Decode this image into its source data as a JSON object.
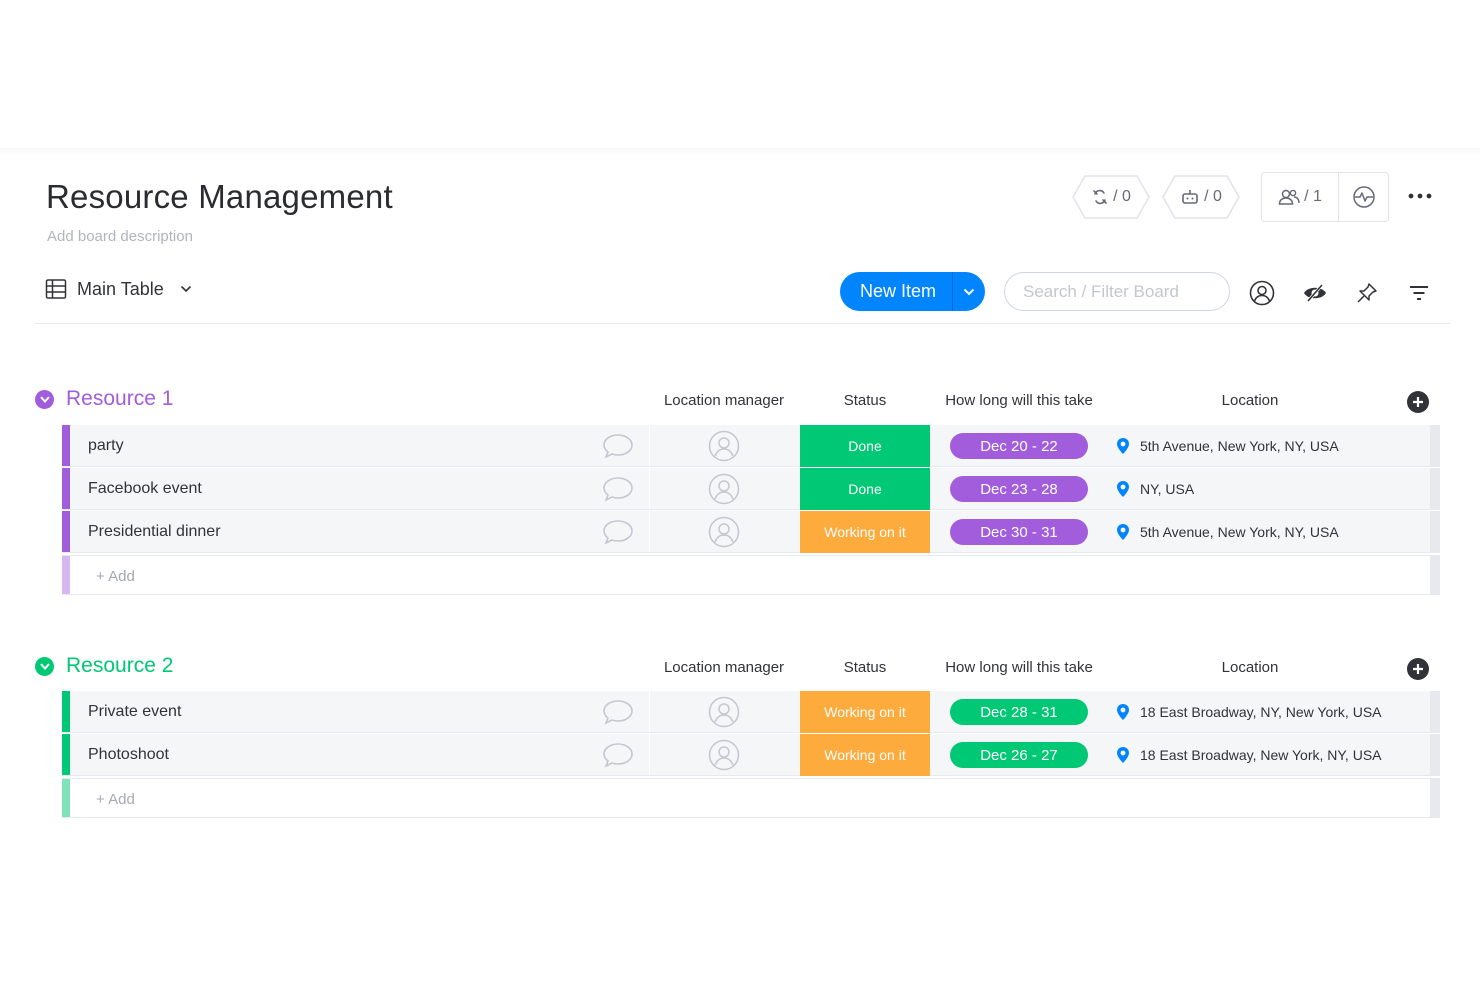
{
  "board": {
    "title": "Resource Management",
    "description_placeholder": "Add board description"
  },
  "header_counters": {
    "integrations": "/ 0",
    "automations": "/ 0",
    "members": "/ 1"
  },
  "toolbar": {
    "view_label": "Main Table",
    "new_item_label": "New Item",
    "search_placeholder": "Search / Filter Board"
  },
  "columns": {
    "location_manager": "Location manager",
    "status": "Status",
    "timeline": "How long will this take",
    "location": "Location"
  },
  "colors": {
    "group1": "#a25ddc",
    "group2": "#00c875",
    "done": "#00c875",
    "working": "#fdab3d",
    "accent": "#0085ff"
  },
  "groups": [
    {
      "title": "Resource 1",
      "add_label": "+ Add",
      "rows": [
        {
          "name": "party",
          "status": "Done",
          "timeline": "Dec 20 - 22",
          "location": "5th Avenue, New York, NY, USA"
        },
        {
          "name": "Facebook event",
          "status": "Done",
          "timeline": "Dec 23 - 28",
          "location": "NY, USA"
        },
        {
          "name": "Presidential dinner",
          "status": "Working on it",
          "timeline": "Dec 30 - 31",
          "location": "5th Avenue, New York, NY, USA"
        }
      ]
    },
    {
      "title": "Resource 2",
      "add_label": "+ Add",
      "rows": [
        {
          "name": "Private event",
          "status": "Working on it",
          "timeline": "Dec 28 - 31",
          "location": "18 East Broadway, NY, New York, USA"
        },
        {
          "name": "Photoshoot",
          "status": "Working on it",
          "timeline": "Dec 26 - 27",
          "location": "18 East Broadway, New York, NY, USA"
        }
      ]
    }
  ]
}
